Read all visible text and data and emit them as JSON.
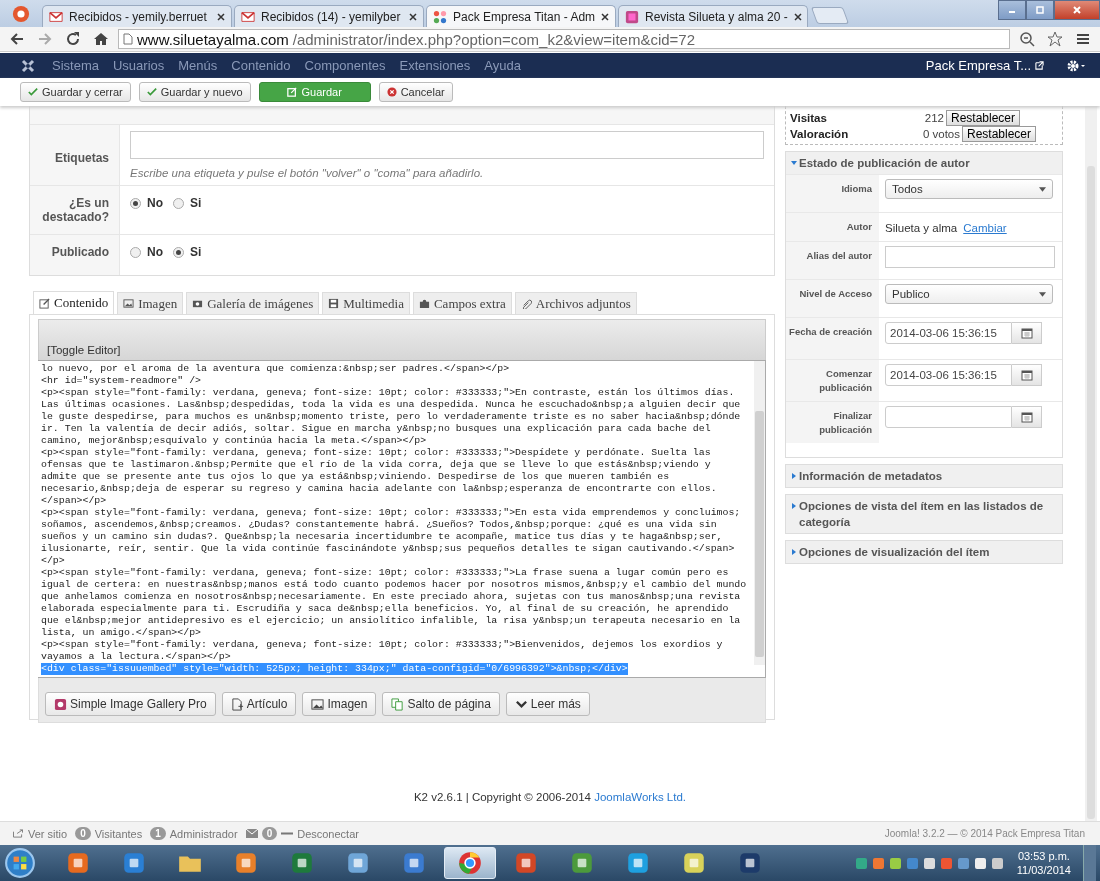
{
  "browser": {
    "tabs": [
      {
        "title": "Recibidos - yemily.berruet",
        "kind": "mail",
        "selected": false
      },
      {
        "title": "Recibidos (14) - yemilyber",
        "kind": "mail",
        "selected": false
      },
      {
        "title": "Pack Empresa Titan - Adm",
        "kind": "cms",
        "selected": true
      },
      {
        "title": "Revista Silueta y alma 20 -",
        "kind": "magazine",
        "selected": false
      }
    ],
    "url_host": "www.siluetayalma.com",
    "url_path": "/administrator/index.php?option=com_k2&view=item&cid=72"
  },
  "navbar": {
    "menu": [
      "Sistema",
      "Usuarios",
      "Menús",
      "Contenido",
      "Componentes",
      "Extensiones",
      "Ayuda"
    ],
    "site": "Pack Empresa T..."
  },
  "toolbar": [
    {
      "label": "Guardar y cerrar",
      "kind": "check"
    },
    {
      "label": "Guardar y nuevo",
      "kind": "check"
    },
    {
      "label": "Guardar",
      "kind": "primary"
    },
    {
      "label": "Cancelar",
      "kind": "cancel"
    }
  ],
  "form": {
    "tags": {
      "label": "Etiquetas",
      "hint": "Escribe una etiqueta y pulse el botón \"volver\" o \"coma\" para añadirlo."
    },
    "radios": [
      {
        "label": "¿Es un destacado?",
        "options": [
          {
            "label": "No",
            "selected": true
          },
          {
            "label": "Si",
            "selected": false
          }
        ]
      },
      {
        "label": "Publicado",
        "options": [
          {
            "label": "No",
            "selected": false
          },
          {
            "label": "Si",
            "selected": true
          }
        ]
      }
    ]
  },
  "editor": {
    "tabs": [
      {
        "label": "Contenido",
        "kind": "edit",
        "selected": true
      },
      {
        "label": "Imagen",
        "kind": "picture",
        "selected": false
      },
      {
        "label": "Galería de imágenes",
        "kind": "camera",
        "selected": false
      },
      {
        "label": "Multimedia",
        "kind": "film",
        "selected": false
      },
      {
        "label": "Campos extra",
        "kind": "puzzle",
        "selected": false
      },
      {
        "label": "Archivos adjuntos",
        "kind": "clip",
        "selected": false
      }
    ],
    "toggle": "[Toggle Editor]",
    "lines": [
      {
        "text": "lo nuevo, por el aroma de la aventura que comienza:&nbsp;ser padres.</span></p>",
        "selected": false
      },
      {
        "text": "<hr id=\"system-readmore\" />",
        "selected": false
      },
      {
        "text": "<p><span style=\"font-family: verdana, geneva; font-size: 10pt; color: #333333;\">En contraste, están los últimos días.",
        "selected": false
      },
      {
        "text": "Las últimas ocasiones. Las&nbsp;despedidas, toda la vida es una despedida. Nunca he escuchado&nbsp;a alguien decir que",
        "selected": false
      },
      {
        "text": "le guste despedirse, para muchos es un&nbsp;momento triste, pero lo verdaderamente triste es no saber hacia&nbsp;dónde",
        "selected": false
      },
      {
        "text": "ir. Ten la valentía de decir adiós, soltar. Sigue en marcha y&nbsp;no busques una explicación para cada bache del",
        "selected": false
      },
      {
        "text": "camino, mejor&nbsp;esquívalo y continúa hacia la meta.</span></p>",
        "selected": false
      },
      {
        "text": "<p><span style=\"font-family: verdana, geneva; font-size: 10pt; color: #333333;\">Despídete y perdónate. Suelta las",
        "selected": false
      },
      {
        "text": "ofensas que te lastimaron.&nbsp;Permite que el río de la vida corra, deja que se lleve lo que estás&nbsp;viendo y",
        "selected": false
      },
      {
        "text": "admite que se presente ante tus ojos lo que ya está&nbsp;viniendo. Despedirse de los que mueren también es",
        "selected": false
      },
      {
        "text": "necesario,&nbsp;deja de esperar su regreso y camina hacia adelante con la&nbsp;esperanza de encontrarte con ellos.",
        "selected": false
      },
      {
        "text": "</span></p>",
        "selected": false
      },
      {
        "text": "<p><span style=\"font-family: verdana, geneva; font-size: 10pt; color: #333333;\">En esta vida emprendemos y concluimos;",
        "selected": false
      },
      {
        "text": "soñamos, ascendemos,&nbsp;creamos. ¿Dudas? constantemente habrá. ¿Sueños? Todos,&nbsp;porque: ¿qué es una vida sin",
        "selected": false
      },
      {
        "text": "sueños y un camino sin dudas?. Que&nbsp;la necesaria incertidumbre te acompañe, matice tus días y te haga&nbsp;ser,",
        "selected": false
      },
      {
        "text": "ilusionarte, reír, sentir. Que la vida continúe fascinándote y&nbsp;sus pequeños detalles te sigan cautivando.</span>",
        "selected": false
      },
      {
        "text": "</p>",
        "selected": false
      },
      {
        "text": "<p><span style=\"font-family: verdana, geneva; font-size: 10pt; color: #333333;\">La frase suena a lugar común pero es",
        "selected": false
      },
      {
        "text": "igual de certera: en nuestras&nbsp;manos está todo cuanto podemos hacer por nosotros mismos,&nbsp;y el cambio del mundo",
        "selected": false
      },
      {
        "text": "que anhelamos comienza en nosotros&nbsp;necesariamente. En este preciado ahora, sujetas con tus manos&nbsp;una revista",
        "selected": false
      },
      {
        "text": "elaborada especialmente para ti. Escrudiña y saca de&nbsp;ella beneficios. Yo, al final de su creación, he aprendido",
        "selected": false
      },
      {
        "text": "que el&nbsp;mejor antidepresivo es el ejercicio; un ansiolítico infalible, la risa y&nbsp;un terapeuta necesario en la",
        "selected": false
      },
      {
        "text": "lista, un amigo.</span></p>",
        "selected": false
      },
      {
        "text": "<p><span style=\"font-family: verdana, geneva; font-size: 10pt; color: #333333;\">Bienvenidos, dejemos los exordios y",
        "selected": false
      },
      {
        "text": "vayamos a la lectura.</span></p>",
        "selected": false
      },
      {
        "text": "<div class=\"issuuembed\" style=\"width: 525px; height: 334px;\" data-configid=\"0/6996392\">&nbsp;</div>",
        "selected": true
      }
    ],
    "buttons": [
      {
        "label": "Simple Image Gallery Pro",
        "kind": "gallery"
      },
      {
        "label": "Artículo",
        "kind": "article"
      },
      {
        "label": "Imagen",
        "kind": "picture"
      },
      {
        "label": "Salto de página",
        "kind": "pages"
      },
      {
        "label": "Leer más",
        "kind": "chevron"
      }
    ]
  },
  "sidebar": {
    "stats": [
      {
        "label": "Visitas",
        "value": "212",
        "button": "Restablecer"
      },
      {
        "label": "Valoración",
        "value": "0 votos",
        "button": "Restablecer"
      }
    ],
    "sections": [
      {
        "title": "Estado de publicación de autor",
        "expanded": true,
        "fields": [
          {
            "label": "Idioma",
            "kind": "select",
            "value": "Todos"
          },
          {
            "label": "Autor",
            "kind": "text",
            "value": "Silueta y alma",
            "link": "Cambiar"
          },
          {
            "label": "Alias del autor",
            "kind": "input"
          },
          {
            "label": "Nivel de Acceso",
            "kind": "select",
            "value": "Publico"
          },
          {
            "label": "Fecha de creación",
            "kind": "date",
            "value": "2014-03-06 15:36:15"
          },
          {
            "label": "Comenzar publicación",
            "kind": "date",
            "value": "2014-03-06 15:36:15"
          },
          {
            "label": "Finalizar publicación",
            "kind": "date"
          }
        ]
      },
      {
        "title": "Información de metadatos",
        "expanded": false
      },
      {
        "title": "Opciones de vista del ítem en las listados de categoría",
        "expanded": false
      },
      {
        "title": "Opciones de visualización del ítem",
        "expanded": false
      }
    ]
  },
  "footer": {
    "text": "K2 v2.6.1 | Copyright © 2006-2014",
    "link": "JoomlaWorks Ltd."
  },
  "status_bar": {
    "view_site": "Ver sitio",
    "visitors_count": "0",
    "visitors": "Visitantes",
    "admins_count": "1",
    "admins": "Administrador",
    "messages_count": "0",
    "logout": "Desconectar",
    "version": "Joomla! 3.2.2  —  © 2014 Pack Empresa Titan"
  },
  "taskbar": {
    "apps": [
      {
        "kind": "fox",
        "selected": false
      },
      {
        "kind": "letter",
        "selected": false
      },
      {
        "kind": "folder",
        "selected": false
      },
      {
        "kind": "play",
        "selected": false
      },
      {
        "kind": "sheet",
        "selected": false
      },
      {
        "kind": "pad",
        "selected": false
      },
      {
        "kind": "arrows",
        "selected": false
      },
      {
        "kind": "browser",
        "selected": true
      },
      {
        "kind": "slides",
        "selected": false
      },
      {
        "kind": "people",
        "selected": false
      },
      {
        "kind": "chat",
        "selected": false
      },
      {
        "kind": "notes",
        "selected": false
      },
      {
        "kind": "photo",
        "selected": false
      }
    ],
    "time": "03:53 p.m.",
    "date": "11/03/2014"
  }
}
